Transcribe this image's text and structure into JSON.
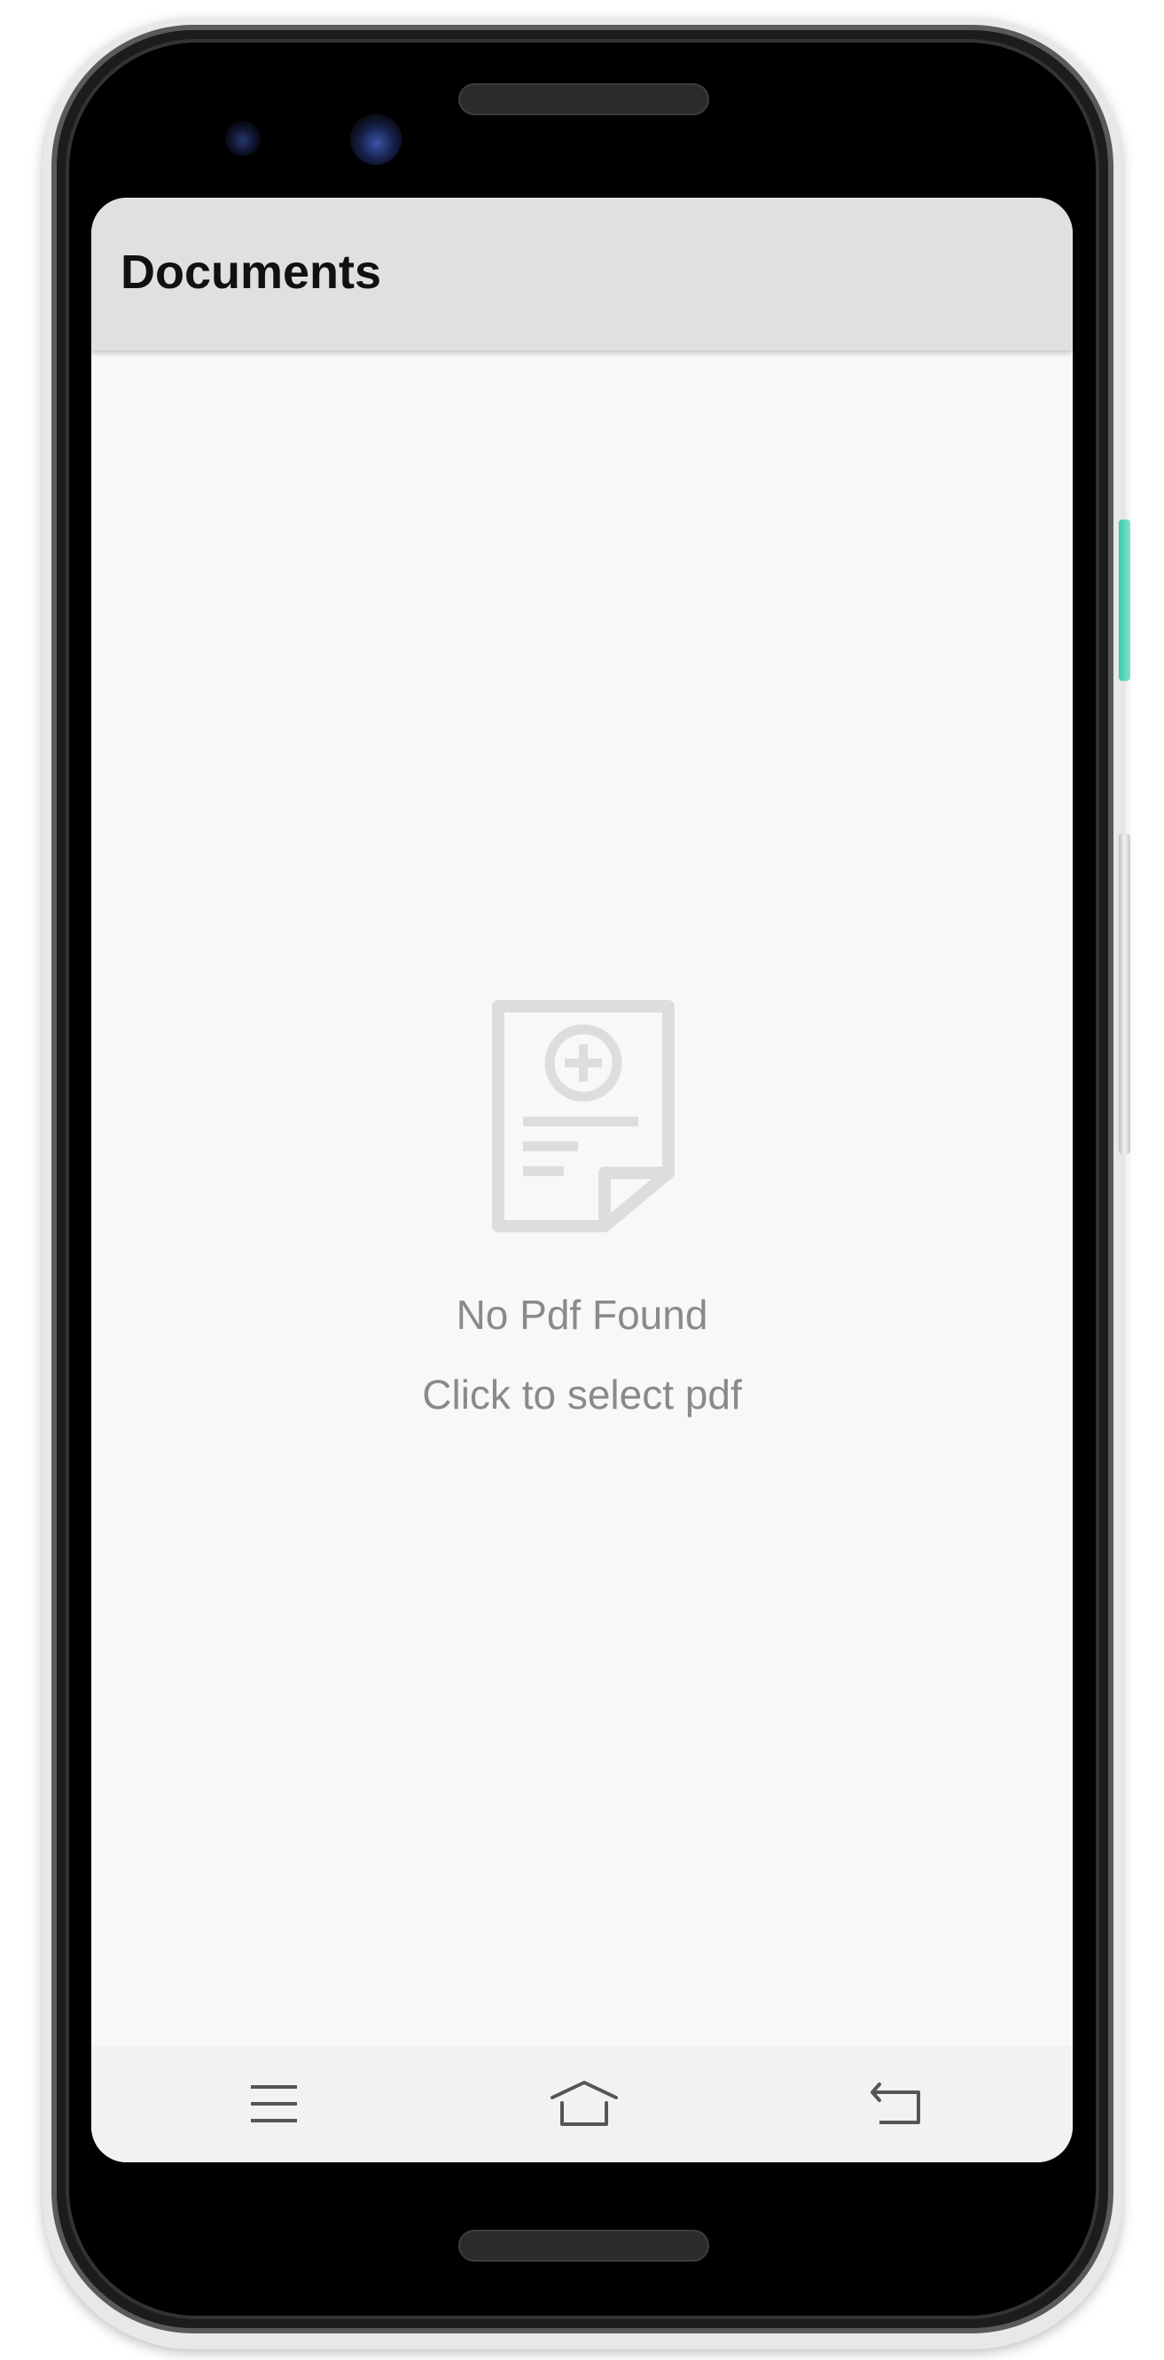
{
  "app_bar": {
    "title": "Documents"
  },
  "empty_state": {
    "icon": "pdf-add-icon",
    "title": "No Pdf Found",
    "subtitle": "Click to select pdf"
  },
  "nav_bar": {
    "buttons": [
      {
        "icon": "menu-icon"
      },
      {
        "icon": "home-icon"
      },
      {
        "icon": "back-icon"
      }
    ]
  },
  "colors": {
    "app_bar_bg": "#e0e0e0",
    "screen_bg": "#f8f8f8",
    "empty_text": "#8a8a8a",
    "icon_gray": "#dddddd",
    "accent_side_button": "#37c9a8"
  }
}
